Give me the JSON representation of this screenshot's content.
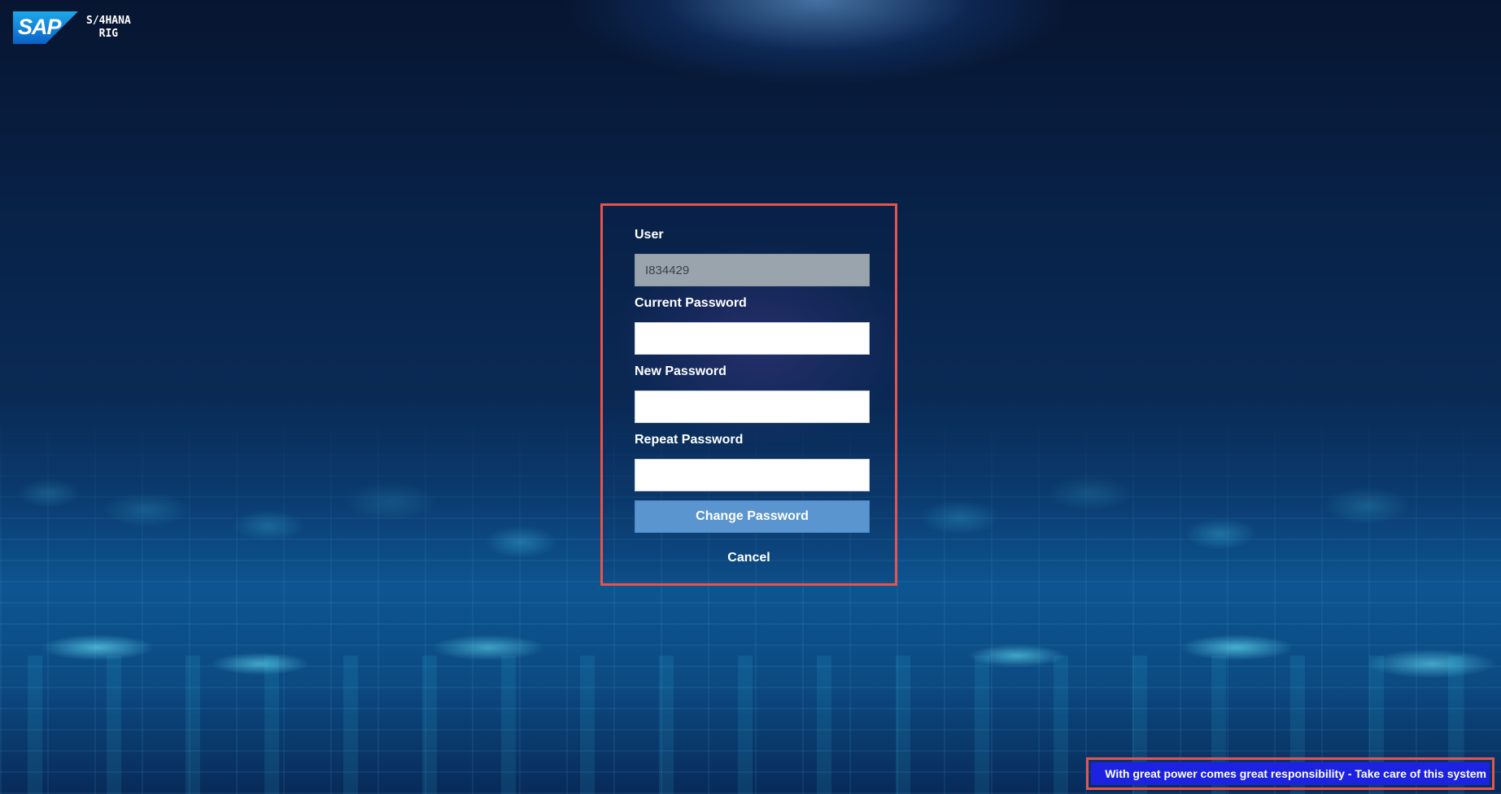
{
  "branding": {
    "logo_text": "SAP",
    "product_line1": "S/4HANA",
    "product_line2": "RIG"
  },
  "form": {
    "user_label": "User",
    "user_value": "I834429",
    "current_password_label": "Current Password",
    "current_password_value": "",
    "new_password_label": "New Password",
    "new_password_value": "",
    "repeat_password_label": "Repeat Password",
    "repeat_password_value": "",
    "change_button_label": "Change Password",
    "cancel_label": "Cancel"
  },
  "footer": {
    "banner_text": "With great power comes great responsibility - Take care of this system"
  },
  "colors": {
    "highlight_border": "#e5554f",
    "button": "#5b95cf",
    "banner_bg": "#1d22e0",
    "readonly_field": "#9aa4ad"
  }
}
